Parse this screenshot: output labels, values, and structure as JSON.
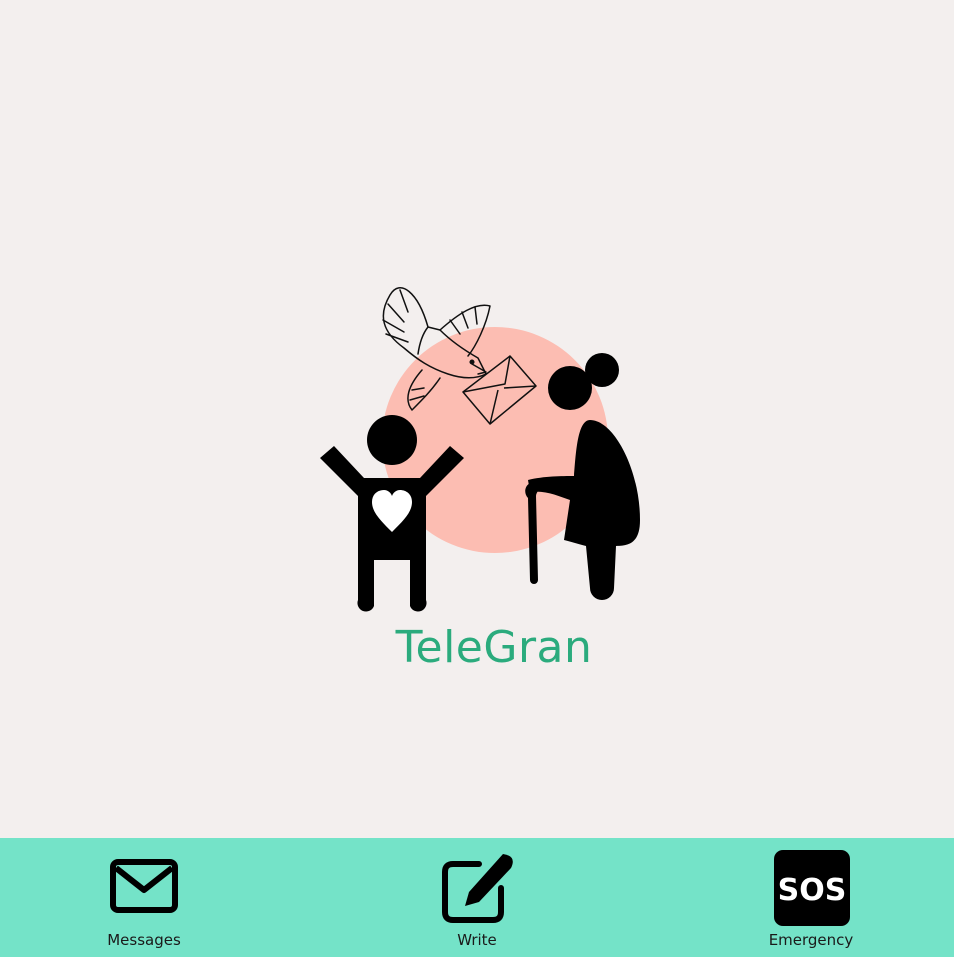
{
  "app": {
    "name": "TeleGran",
    "brand_color": "#2bab7d",
    "background": "#f3efee",
    "logo_circle_color": "#fcbdb2"
  },
  "tabbar": {
    "background": "#74e3c8",
    "items": [
      {
        "id": "messages",
        "label": "Messages",
        "icon": "envelope-icon"
      },
      {
        "id": "write",
        "label": "Write",
        "icon": "pencil-square-icon"
      },
      {
        "id": "emergency",
        "label": "Emergency",
        "icon": "sos-icon",
        "icon_text": "SOS"
      }
    ]
  }
}
